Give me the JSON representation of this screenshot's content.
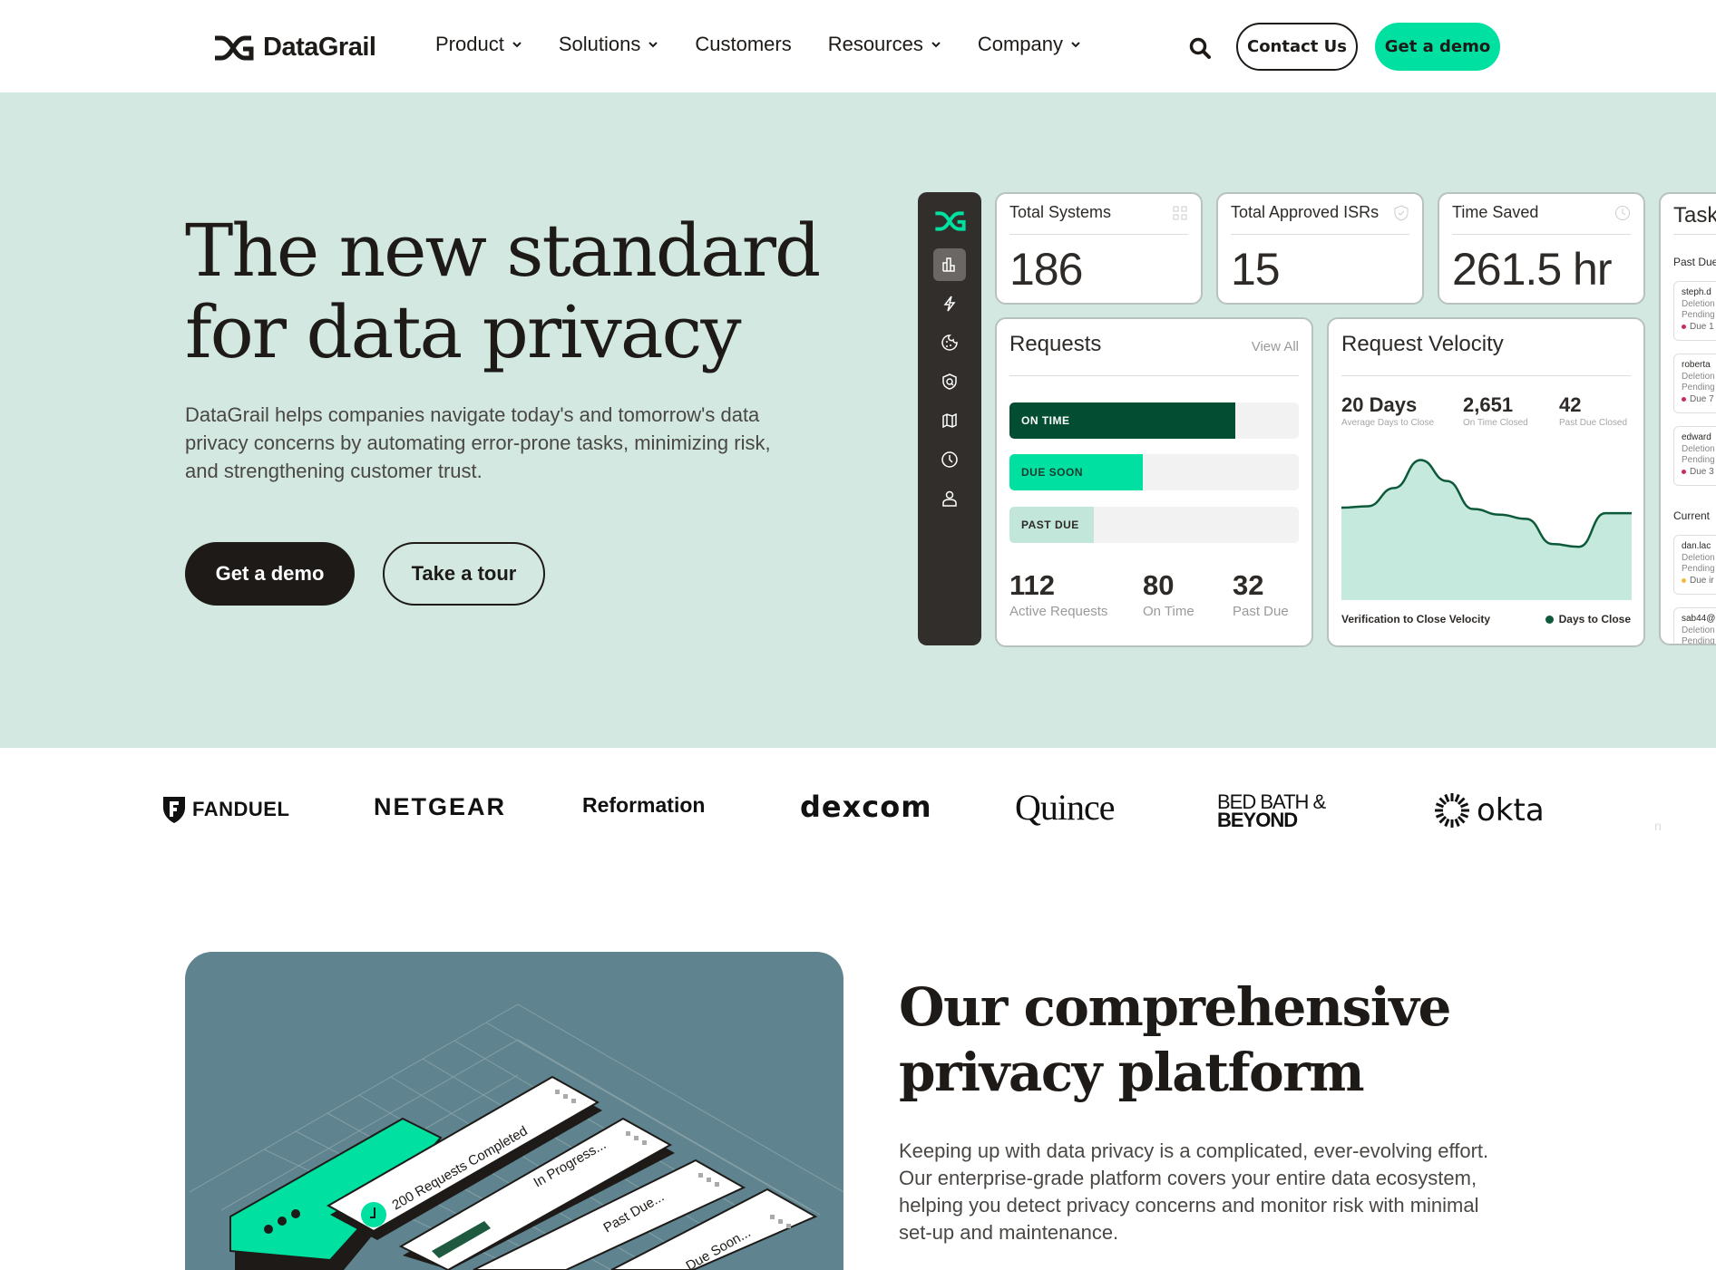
{
  "nav": {
    "brand": "DataGrail",
    "links": [
      {
        "label": "Product",
        "dropdown": true
      },
      {
        "label": "Solutions",
        "dropdown": true
      },
      {
        "label": "Customers",
        "dropdown": false
      },
      {
        "label": "Resources",
        "dropdown": true
      },
      {
        "label": "Company",
        "dropdown": true
      }
    ],
    "search_icon": "search-icon",
    "contact_label": "Contact Us",
    "demo_label": "Get a demo"
  },
  "hero": {
    "title_line1": "The new standard",
    "title_line2": "for data privacy",
    "subtitle": "DataGrail helps companies navigate today's and tomorrow's data privacy concerns by automating error-prone tasks, minimizing risk, and strengthening customer trust.",
    "primary_cta": "Get a demo",
    "secondary_cta": "Take a tour",
    "bg_color": "#d2e8e0"
  },
  "dashboard": {
    "sidebar": {
      "icons": [
        "chart-bar-icon",
        "lightning-icon",
        "cookie-icon",
        "shield-search-icon",
        "map-icon",
        "clock-icon",
        "user-icon"
      ],
      "active_index": 0
    },
    "stats": [
      {
        "title": "Total Systems",
        "value": "186",
        "icon": "grid-icon"
      },
      {
        "title": "Total Approved ISRs",
        "value": "15",
        "icon": "shield-check-icon"
      },
      {
        "title": "Time Saved",
        "value": "261.5 hr",
        "icon": "clock-icon"
      }
    ],
    "requests": {
      "title": "Requests",
      "view_all": "View All",
      "bars": [
        {
          "label": "ON TIME",
          "fraction": 0.78,
          "color": "#034d33",
          "text_color": "#ffffff"
        },
        {
          "label": "DUE SOON",
          "fraction": 0.46,
          "color": "#00e0a1",
          "text_color": "#1d3a30"
        },
        {
          "label": "PAST DUE",
          "fraction": 0.29,
          "color": "#c3e6db",
          "text_color": "#2d2a27"
        }
      ],
      "summary": [
        {
          "value": "112",
          "label": "Active Requests"
        },
        {
          "value": "80",
          "label": "On Time"
        },
        {
          "value": "32",
          "label": "Past Due"
        }
      ]
    },
    "velocity": {
      "title": "Request Velocity",
      "stats": [
        {
          "value": "20 Days",
          "label": "Average Days to Close"
        },
        {
          "value": "2,651",
          "label": "On Time Closed"
        },
        {
          "value": "42",
          "label": "Past Due Closed"
        }
      ],
      "footer_label": "Verification to Close Velocity",
      "legend_label": "Days to Close",
      "line_color": "#0d5a3a",
      "fill_color": "#c5e9dc"
    },
    "tasks": {
      "title": "Task",
      "past_due_label": "Past Due",
      "current_label": "Current",
      "past_due": [
        {
          "user": "steph.d",
          "type": "Deletion",
          "status": "Pending",
          "due": "Due 1"
        },
        {
          "user": "roberta",
          "type": "Deletion",
          "status": "Pending",
          "due": "Due 7"
        },
        {
          "user": "edward",
          "type": "Deletion",
          "status": "Pending",
          "due": "Due 3"
        }
      ],
      "current": [
        {
          "user": "dan.lac",
          "type": "Deletion",
          "status": "Pending",
          "due": "Due ir"
        },
        {
          "user": "sab44@",
          "type": "Deletion",
          "status": "Pending",
          "due": ""
        }
      ]
    }
  },
  "chart_data": {
    "type": "area",
    "title": "Request Velocity",
    "xlabel": "Verification to Close Velocity",
    "ylabel": "",
    "series": [
      {
        "name": "Days to Close",
        "values": [
          0.66,
          0.67,
          0.8,
          1.0,
          0.85,
          0.65,
          0.61,
          0.58,
          0.4,
          0.38,
          0.62,
          0.62
        ]
      }
    ],
    "x": [
      0,
      1,
      2,
      3,
      4,
      5,
      6,
      7,
      8,
      9,
      10,
      11
    ],
    "ylim": [
      0,
      1.1
    ],
    "grid": false,
    "legend": "bottom-right"
  },
  "logos": [
    "FANDUEL",
    "NETGEAR",
    "Reformation",
    "dexcom",
    "Quince",
    "BED BATH & BEYOND",
    "okta",
    "n"
  ],
  "platform": {
    "title_line1": "Our comprehensive",
    "title_line2": "privacy platform",
    "subtitle": "Keeping up with data privacy is a complicated, ever-evolving effort. Our enterprise-grade platform covers your entire data ecosystem, helping you detect privacy concerns and monitor risk with minimal set-up and maintenance.",
    "illustration": {
      "cards": [
        "200 Requests Completed",
        "In Progress...",
        "Past Due...",
        "Due Soon..."
      ]
    }
  }
}
